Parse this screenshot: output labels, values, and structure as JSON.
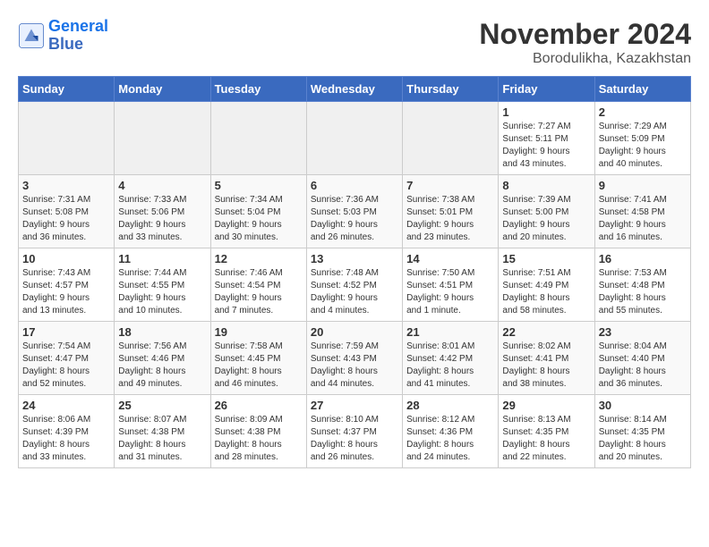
{
  "logo": {
    "line1": "General",
    "line2": "Blue"
  },
  "title": "November 2024",
  "location": "Borodulikha, Kazakhstan",
  "weekdays": [
    "Sunday",
    "Monday",
    "Tuesday",
    "Wednesday",
    "Thursday",
    "Friday",
    "Saturday"
  ],
  "weeks": [
    [
      {
        "day": "",
        "info": ""
      },
      {
        "day": "",
        "info": ""
      },
      {
        "day": "",
        "info": ""
      },
      {
        "day": "",
        "info": ""
      },
      {
        "day": "",
        "info": ""
      },
      {
        "day": "1",
        "info": "Sunrise: 7:27 AM\nSunset: 5:11 PM\nDaylight: 9 hours\nand 43 minutes."
      },
      {
        "day": "2",
        "info": "Sunrise: 7:29 AM\nSunset: 5:09 PM\nDaylight: 9 hours\nand 40 minutes."
      }
    ],
    [
      {
        "day": "3",
        "info": "Sunrise: 7:31 AM\nSunset: 5:08 PM\nDaylight: 9 hours\nand 36 minutes."
      },
      {
        "day": "4",
        "info": "Sunrise: 7:33 AM\nSunset: 5:06 PM\nDaylight: 9 hours\nand 33 minutes."
      },
      {
        "day": "5",
        "info": "Sunrise: 7:34 AM\nSunset: 5:04 PM\nDaylight: 9 hours\nand 30 minutes."
      },
      {
        "day": "6",
        "info": "Sunrise: 7:36 AM\nSunset: 5:03 PM\nDaylight: 9 hours\nand 26 minutes."
      },
      {
        "day": "7",
        "info": "Sunrise: 7:38 AM\nSunset: 5:01 PM\nDaylight: 9 hours\nand 23 minutes."
      },
      {
        "day": "8",
        "info": "Sunrise: 7:39 AM\nSunset: 5:00 PM\nDaylight: 9 hours\nand 20 minutes."
      },
      {
        "day": "9",
        "info": "Sunrise: 7:41 AM\nSunset: 4:58 PM\nDaylight: 9 hours\nand 16 minutes."
      }
    ],
    [
      {
        "day": "10",
        "info": "Sunrise: 7:43 AM\nSunset: 4:57 PM\nDaylight: 9 hours\nand 13 minutes."
      },
      {
        "day": "11",
        "info": "Sunrise: 7:44 AM\nSunset: 4:55 PM\nDaylight: 9 hours\nand 10 minutes."
      },
      {
        "day": "12",
        "info": "Sunrise: 7:46 AM\nSunset: 4:54 PM\nDaylight: 9 hours\nand 7 minutes."
      },
      {
        "day": "13",
        "info": "Sunrise: 7:48 AM\nSunset: 4:52 PM\nDaylight: 9 hours\nand 4 minutes."
      },
      {
        "day": "14",
        "info": "Sunrise: 7:50 AM\nSunset: 4:51 PM\nDaylight: 9 hours\nand 1 minute."
      },
      {
        "day": "15",
        "info": "Sunrise: 7:51 AM\nSunset: 4:49 PM\nDaylight: 8 hours\nand 58 minutes."
      },
      {
        "day": "16",
        "info": "Sunrise: 7:53 AM\nSunset: 4:48 PM\nDaylight: 8 hours\nand 55 minutes."
      }
    ],
    [
      {
        "day": "17",
        "info": "Sunrise: 7:54 AM\nSunset: 4:47 PM\nDaylight: 8 hours\nand 52 minutes."
      },
      {
        "day": "18",
        "info": "Sunrise: 7:56 AM\nSunset: 4:46 PM\nDaylight: 8 hours\nand 49 minutes."
      },
      {
        "day": "19",
        "info": "Sunrise: 7:58 AM\nSunset: 4:45 PM\nDaylight: 8 hours\nand 46 minutes."
      },
      {
        "day": "20",
        "info": "Sunrise: 7:59 AM\nSunset: 4:43 PM\nDaylight: 8 hours\nand 44 minutes."
      },
      {
        "day": "21",
        "info": "Sunrise: 8:01 AM\nSunset: 4:42 PM\nDaylight: 8 hours\nand 41 minutes."
      },
      {
        "day": "22",
        "info": "Sunrise: 8:02 AM\nSunset: 4:41 PM\nDaylight: 8 hours\nand 38 minutes."
      },
      {
        "day": "23",
        "info": "Sunrise: 8:04 AM\nSunset: 4:40 PM\nDaylight: 8 hours\nand 36 minutes."
      }
    ],
    [
      {
        "day": "24",
        "info": "Sunrise: 8:06 AM\nSunset: 4:39 PM\nDaylight: 8 hours\nand 33 minutes."
      },
      {
        "day": "25",
        "info": "Sunrise: 8:07 AM\nSunset: 4:38 PM\nDaylight: 8 hours\nand 31 minutes."
      },
      {
        "day": "26",
        "info": "Sunrise: 8:09 AM\nSunset: 4:38 PM\nDaylight: 8 hours\nand 28 minutes."
      },
      {
        "day": "27",
        "info": "Sunrise: 8:10 AM\nSunset: 4:37 PM\nDaylight: 8 hours\nand 26 minutes."
      },
      {
        "day": "28",
        "info": "Sunrise: 8:12 AM\nSunset: 4:36 PM\nDaylight: 8 hours\nand 24 minutes."
      },
      {
        "day": "29",
        "info": "Sunrise: 8:13 AM\nSunset: 4:35 PM\nDaylight: 8 hours\nand 22 minutes."
      },
      {
        "day": "30",
        "info": "Sunrise: 8:14 AM\nSunset: 4:35 PM\nDaylight: 8 hours\nand 20 minutes."
      }
    ]
  ]
}
